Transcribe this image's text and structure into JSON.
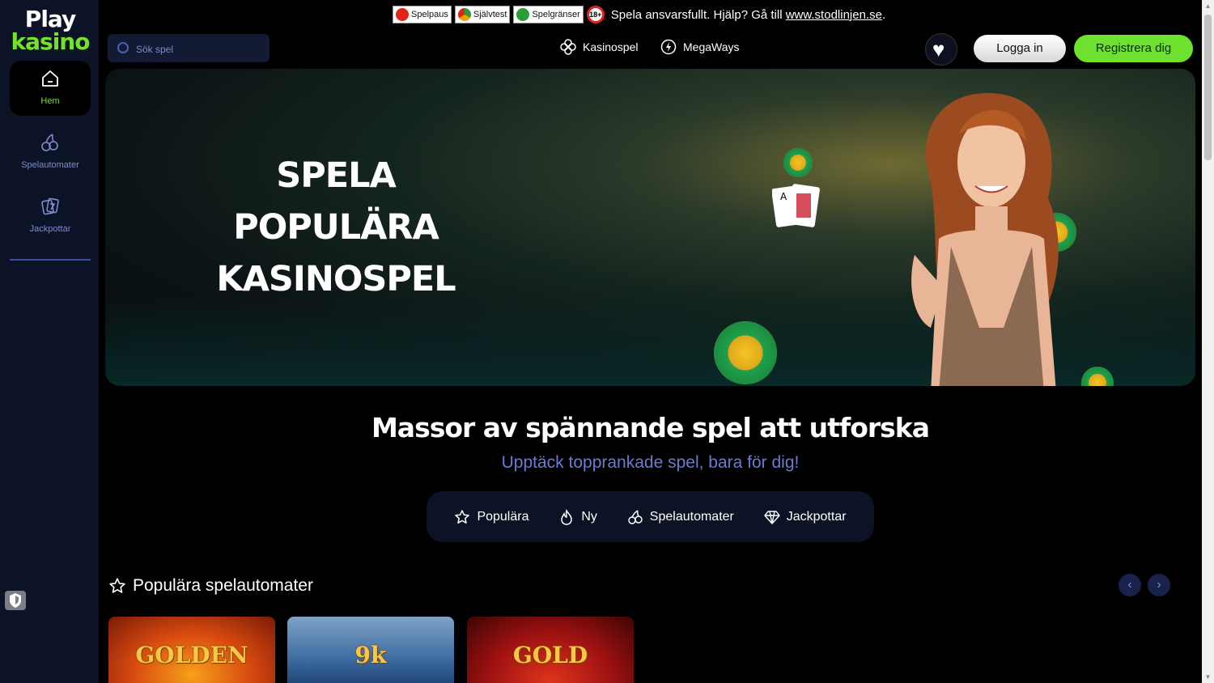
{
  "logo": {
    "line1": "Play",
    "line2": "kasino"
  },
  "sidebar": {
    "items": [
      {
        "label": "Hem",
        "icon": "home-icon",
        "active": true
      },
      {
        "label": "Spelautomater",
        "icon": "cherries-icon",
        "active": false
      },
      {
        "label": "Jackpottar",
        "icon": "slot-cards-icon",
        "active": false
      }
    ]
  },
  "rg": {
    "buttons": [
      {
        "label": "Spelpaus",
        "icon": "pause-icon",
        "color": "#e2231a"
      },
      {
        "label": "Självtest",
        "icon": "gauge-icon",
        "color": "#f0a000"
      },
      {
        "label": "Spelgränser",
        "icon": "limit-icon",
        "color": "#2a9d3a"
      }
    ],
    "age": "18+",
    "text": "Spela ansvarsfullt. Hjälp? Gå till ",
    "link": "www.stodlinjen.se",
    "text_end": "."
  },
  "search": {
    "placeholder": "Sök spel"
  },
  "topnav": [
    {
      "label": "Kasinospel",
      "icon": "clover-icon"
    },
    {
      "label": "MegaWays",
      "icon": "bolt-circle-icon"
    }
  ],
  "header": {
    "login": "Logga in",
    "register": "Registrera dig",
    "favorites_icon": "heart-icon"
  },
  "hero": {
    "title_line1": "SPELA POPULÄRA",
    "title_line2": "KASINOSPEL"
  },
  "section": {
    "title": "Massor av spännande spel att utforska",
    "subtitle": "Upptäck topprankade spel, bara för dig!",
    "tabs": [
      {
        "label": "Populära",
        "icon": "star-icon"
      },
      {
        "label": "Ny",
        "icon": "flame-icon"
      },
      {
        "label": "Spelautomater",
        "icon": "cherries-icon"
      },
      {
        "label": "Jackpottar",
        "icon": "diamond-icon"
      }
    ]
  },
  "popular": {
    "title": "Populära spelautomater",
    "tiles": [
      {
        "name": "GOLDEN",
        "color": "#d84a10"
      },
      {
        "name": "9k",
        "color": "#3a6aa0"
      },
      {
        "name": "GOLD",
        "color": "#9a1010"
      }
    ]
  },
  "colors": {
    "accent": "#74e22d",
    "muted": "#7f8cc8",
    "sidebar": "#0c1327"
  }
}
